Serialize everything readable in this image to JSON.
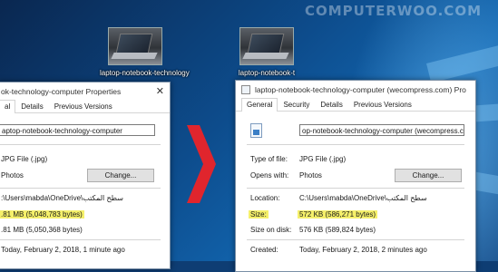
{
  "watermark": "COMPUTERWOO.COM",
  "desktop_icons": [
    {
      "label": "laptop-notebook-technology"
    },
    {
      "label": "laptop-notebook-t"
    }
  ],
  "left_window": {
    "title": "ok-technology-computer Properties",
    "close": "✕",
    "tabs": [
      "al",
      "Details",
      "Previous Versions"
    ],
    "filename": "aptop-notebook-technology-computer",
    "type_value": "JPG File (.jpg)",
    "opens_with_value": "Photos",
    "change_button": "Change...",
    "location_value": ":\\Users\\mabda\\OneDrive\\سطح المكتب",
    "size_value": ".81 MB (5,048,783 bytes)",
    "size_on_disk_value": ".81 MB (5,050,368 bytes)",
    "created_value": "Today, February 2, 2018, 1 minute ago"
  },
  "right_window": {
    "title": "laptop-notebook-technology-computer (wecompress.com) Pro",
    "tabs": [
      "General",
      "Security",
      "Details",
      "Previous Versions"
    ],
    "filename": "op-notebook-technology-computer (wecompress.com)",
    "labels": {
      "type": "Type of file:",
      "opens_with": "Opens with:",
      "location": "Location:",
      "size": "Size:",
      "size_on_disk": "Size on disk:",
      "created": "Created:"
    },
    "type_value": "JPG File (.jpg)",
    "opens_with_value": "Photos",
    "change_button": "Change...",
    "location_value": "C:\\Users\\mabda\\OneDrive\\سطح المكتب",
    "size_value": "572 KB (586,271 bytes)",
    "size_on_disk_value": "576 KB (589,824 bytes)",
    "created_value": "Today, February 2, 2018, 2 minutes ago"
  },
  "colors": {
    "highlight": "#f5f06a",
    "arrow": "#e0252d"
  }
}
